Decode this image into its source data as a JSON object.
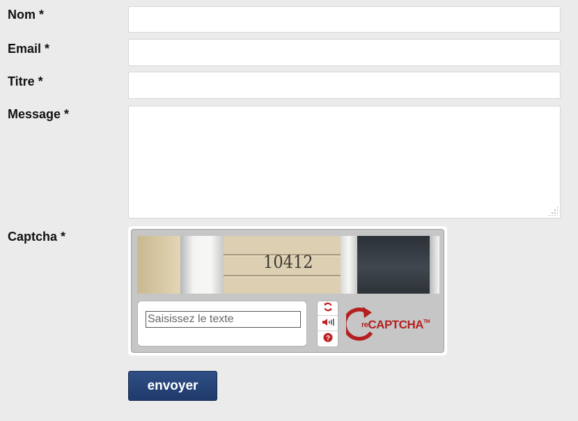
{
  "form": {
    "fields": [
      {
        "label": "Nom *",
        "value": ""
      },
      {
        "label": "Email *",
        "value": ""
      },
      {
        "label": "Titre *",
        "value": ""
      },
      {
        "label": "Message *",
        "value": ""
      }
    ],
    "captcha": {
      "label": "Captcha *",
      "image_text": "10412",
      "input_placeholder": "Saisissez le texte",
      "controls": [
        "refresh-icon",
        "audio-icon",
        "help-icon"
      ],
      "logo_re": "re",
      "logo_name": "CAPTCHA",
      "logo_tm": "TM",
      "accent_color": "#b51f1f"
    },
    "submit_label": "envoyer"
  },
  "colors": {
    "background": "#ebebeb",
    "button": "#264577"
  }
}
